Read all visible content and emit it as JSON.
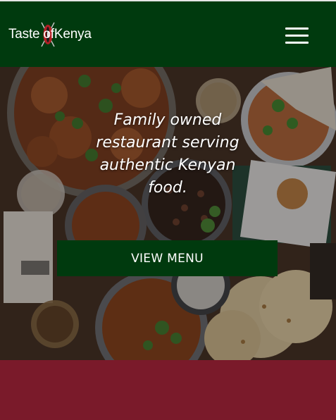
{
  "header": {
    "logo_part1": "Taste ",
    "logo_part2": "of",
    "logo_part3": " Kenya",
    "menu_icon": "hamburger-menu-icon",
    "background": "#003a0e"
  },
  "hero": {
    "tagline": "Family owned restaurant serving authentic Kenyan food.",
    "cta_label": "VIEW MENU",
    "cta_color": "#003a0e"
  },
  "footer": {
    "band_color": "#7a1a2a"
  },
  "icons": {
    "logo_emblem": "maasai-shield-icon"
  }
}
